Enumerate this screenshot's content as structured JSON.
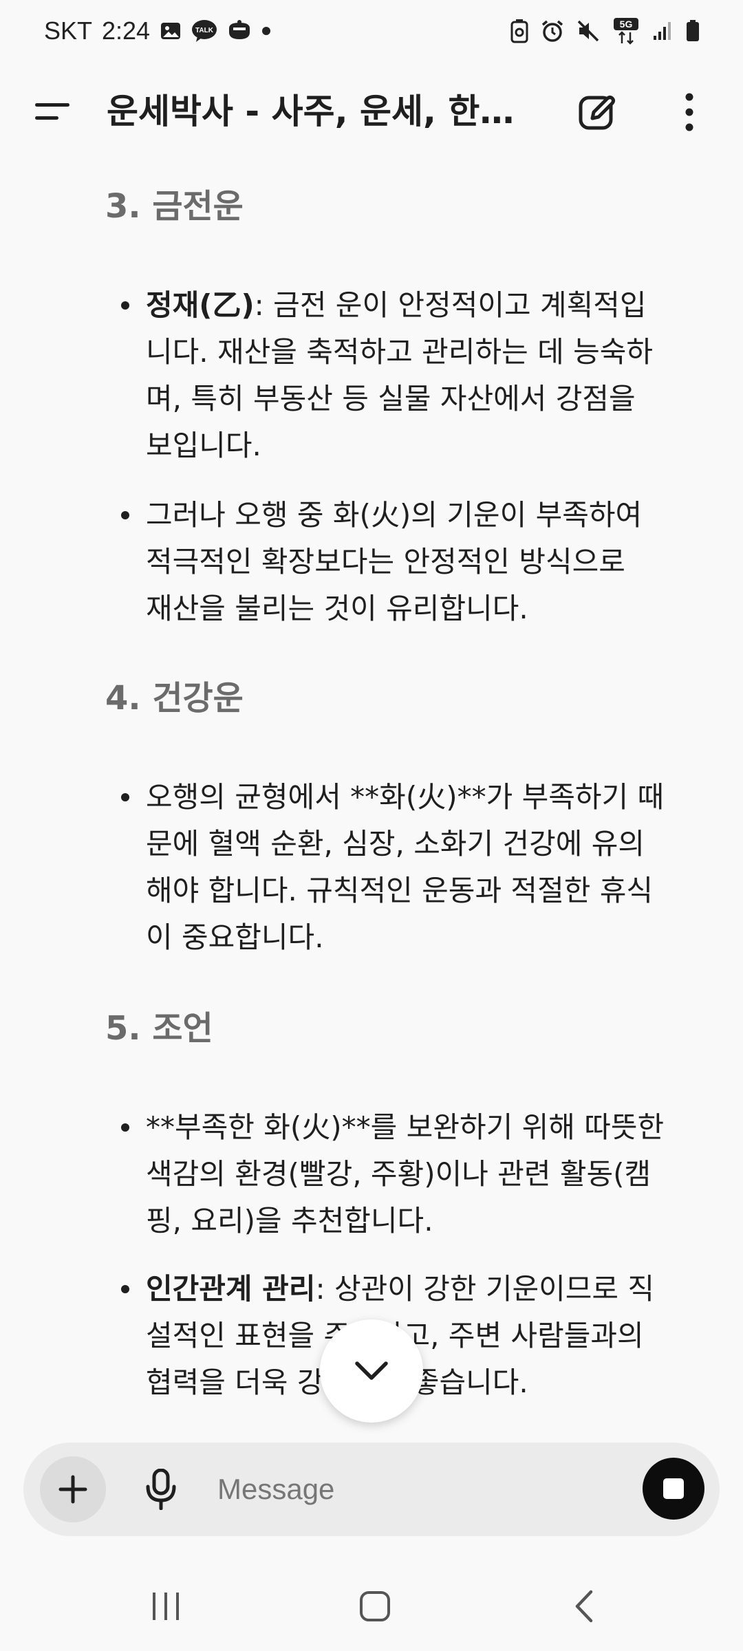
{
  "status_bar": {
    "carrier": "SKT",
    "time": "2:24",
    "left_icons": [
      "gallery-icon",
      "kakaotalk-icon",
      "chat-bubble-icon",
      "dot-icon"
    ],
    "kakaotalk_text": "TALK",
    "right_icons": [
      "battery-saver-icon",
      "alarm-icon",
      "mute-icon",
      "5g-icon",
      "signal-icon",
      "battery-icon"
    ],
    "network": "5G"
  },
  "app_bar": {
    "title": "운세박사 - 사주, 운세, 한…",
    "menu_icon": "menu-icon",
    "edit_icon": "edit-icon",
    "more_icon": "more-vert-icon"
  },
  "sections": [
    {
      "heading": "3. 금전운",
      "bullets": [
        {
          "bold": "정재(乙)",
          "lines": [
            ": 금전 운이 안정적이고 계획적입",
            "니다. 재산을 축적하고 관리하는 데 능숙하",
            "며, 특히 부동산 등 실물 자산에서 강점을",
            "보입니다."
          ]
        },
        {
          "bold": "",
          "lines": [
            "그러나 오행 중 화(火)의 기운이 부족하여",
            "적극적인 확장보다는 안정적인 방식으로",
            "재산을 불리는 것이 유리합니다."
          ]
        }
      ]
    },
    {
      "heading": "4. 건강운",
      "bullets": [
        {
          "bold": "",
          "lines": [
            "오행의 균형에서 **화(火)**가 부족하기 때",
            "문에 혈액 순환, 심장, 소화기 건강에 유의",
            "해야 합니다. 규칙적인 운동과 적절한 휴식",
            "이 중요합니다."
          ]
        }
      ]
    },
    {
      "heading": "5. 조언",
      "bullets": [
        {
          "bold": "",
          "lines": [
            "**부족한 화(火)**를 보완하기 위해 따뜻한",
            "색감의 환경(빨강, 주황)이나 관련 활동(캠",
            "핑, 요리)을 추천합니다."
          ]
        },
        {
          "bold": "인간관계 관리",
          "lines": [
            ": 상관이 강한 기운이므로 직",
            "설적인 표현을 주의하고, 주변 사람들과의",
            "협력을 더욱 강화하면 좋습니다."
          ]
        }
      ]
    }
  ],
  "scroll_button": {
    "icon": "chevron-down-icon"
  },
  "composer": {
    "placeholder": "Message",
    "add_icon": "plus-icon",
    "mic_icon": "mic-icon",
    "stop_icon": "stop-icon"
  },
  "nav_bar": {
    "recents_icon": "recents-icon",
    "home_icon": "home-icon",
    "back_icon": "back-icon"
  }
}
